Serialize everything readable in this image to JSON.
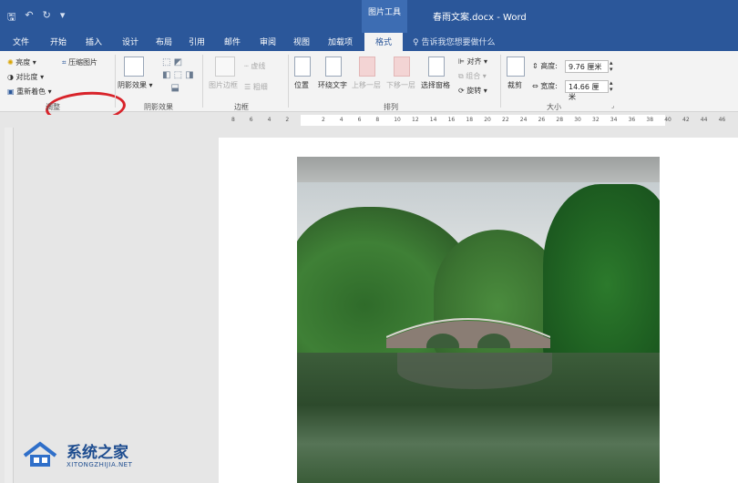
{
  "title_bar": {
    "context_tool": "图片工具",
    "document_title": "春雨文案.docx - Word"
  },
  "tabs": [
    {
      "label": "文件"
    },
    {
      "label": "开始"
    },
    {
      "label": "插入"
    },
    {
      "label": "设计"
    },
    {
      "label": "布局"
    },
    {
      "label": "引用"
    },
    {
      "label": "邮件"
    },
    {
      "label": "审阅"
    },
    {
      "label": "视图"
    },
    {
      "label": "加载项"
    },
    {
      "label": "格式"
    }
  ],
  "tell_me": "告诉我您想要做什么",
  "ribbon": {
    "adjust": {
      "brightness": "亮度",
      "contrast": "对比度",
      "recolor": "重新着色",
      "compress": "压缩图片",
      "label": "调整"
    },
    "shadow": {
      "shadow_effects": "阴影效果",
      "label": "阴影效果"
    },
    "border": {
      "picture_border": "图片边框",
      "dash": "虚线",
      "thickness": "粗细",
      "label": "边框"
    },
    "arrange": {
      "position": "位置",
      "wrap_text": "环绕文字",
      "bring_forward": "上移一层",
      "send_backward": "下移一层",
      "selection_pane": "选择窗格",
      "align": "对齐",
      "group": "组合",
      "rotate": "旋转",
      "label": "排列"
    },
    "size": {
      "crop": "裁剪",
      "height_label": "高度:",
      "height_value": "9.76 厘米",
      "width_label": "宽度:",
      "width_value": "14.66 厘米",
      "label": "大小"
    }
  },
  "ruler_numbers": [
    "8",
    "6",
    "4",
    "2",
    "",
    "2",
    "4",
    "6",
    "8",
    "10",
    "12",
    "14",
    "16",
    "18",
    "20",
    "22",
    "24",
    "26",
    "28",
    "30",
    "32",
    "34",
    "36",
    "38",
    "40",
    "42",
    "44",
    "46"
  ],
  "watermark": {
    "brand": "系统之家",
    "url": "XITONGZHIJIA.NET"
  },
  "colors": {
    "title_blue": "#2b579a",
    "highlight_red": "#d8232a"
  }
}
